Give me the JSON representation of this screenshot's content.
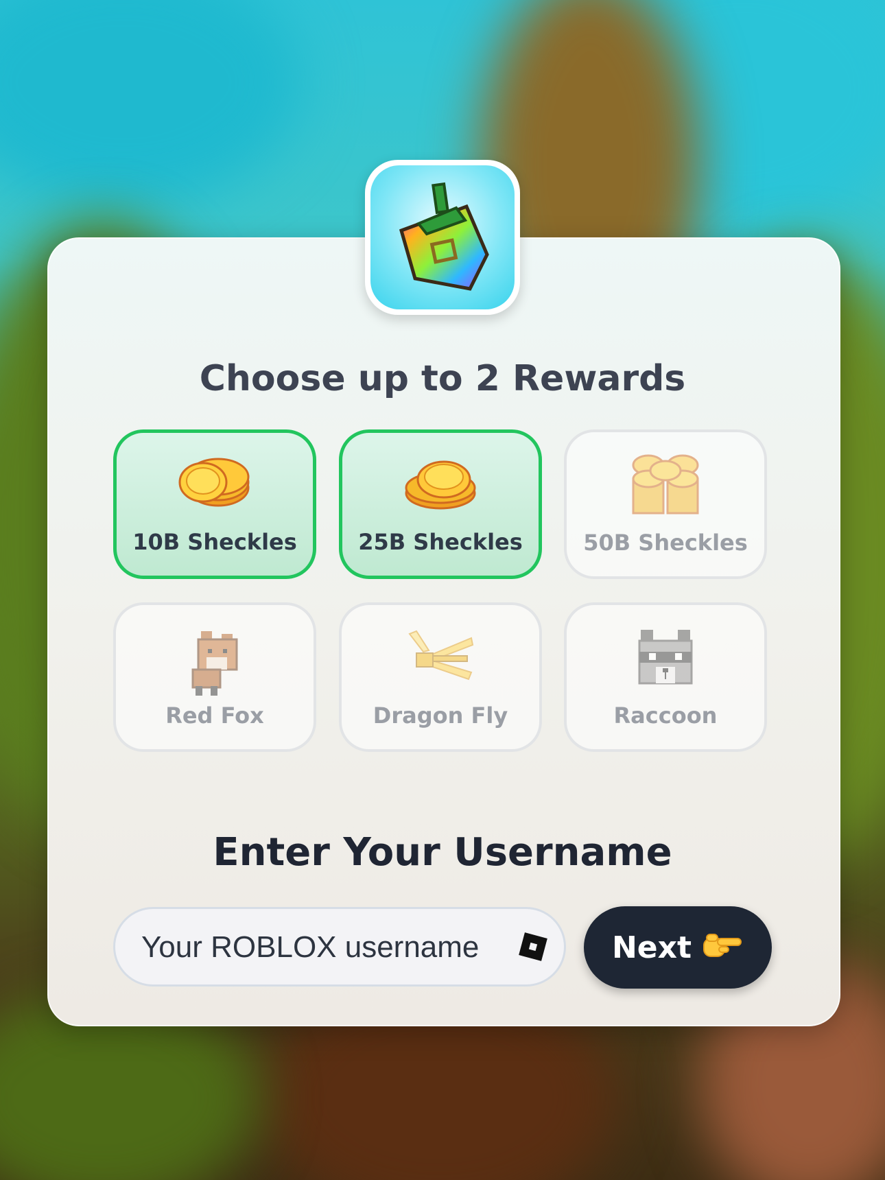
{
  "header": {
    "title": "Choose up to 2 Rewards"
  },
  "rewards": [
    {
      "label": "10B Sheckles",
      "icon": "coin-stack-icon",
      "selected": true
    },
    {
      "label": "25B Sheckles",
      "icon": "coin-stack-icon",
      "selected": true
    },
    {
      "label": "50B Sheckles",
      "icon": "coin-pile-icon",
      "selected": false
    },
    {
      "label": "Red Fox",
      "icon": "red-fox-pet-icon",
      "selected": false
    },
    {
      "label": "Dragon Fly",
      "icon": "dragonfly-pet-icon",
      "selected": false
    },
    {
      "label": "Raccoon",
      "icon": "raccoon-pet-icon",
      "selected": false
    }
  ],
  "username": {
    "heading": "Enter Your Username",
    "placeholder": "Your ROBLOX username",
    "value": ""
  },
  "next_button": {
    "label": "Next",
    "icon": "pointing-hand-icon"
  },
  "colors": {
    "selected_border": "#22c55e",
    "button_bg": "#1e2634",
    "title_text": "#3d4352"
  }
}
